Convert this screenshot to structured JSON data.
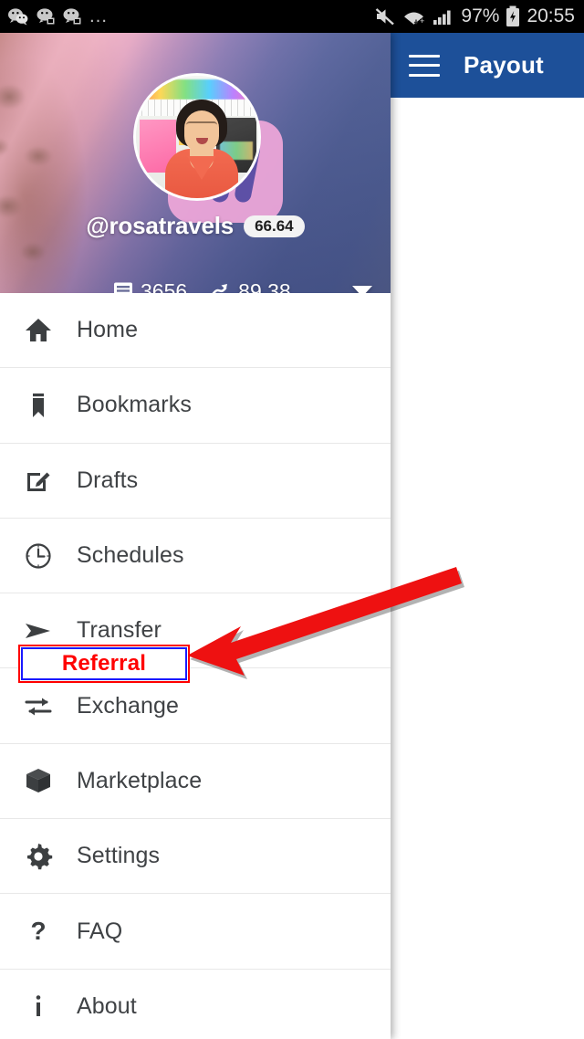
{
  "status_bar": {
    "left_icons": [
      "wechat-icon",
      "wechat-message-icon",
      "wechat-message-icon"
    ],
    "overflow_dots": "…",
    "mute_icon": "mute-icon",
    "wifi_icon": "wifi-icon",
    "signal_icon": "signal-bars-icon",
    "battery_percent": "97%",
    "battery_icon": "battery-charging-icon",
    "clock": "20:55"
  },
  "drawer": {
    "profile": {
      "avatar": "user-avatar",
      "username": "@rosatravels",
      "reputation": "66.64",
      "stats": [
        {
          "icon": "post-count-icon",
          "value": "3656"
        },
        {
          "icon": "trending-up-icon",
          "value": "89.38"
        }
      ],
      "expand_icon": "chevron-down-icon"
    },
    "menu_items": [
      {
        "icon": "home-icon",
        "label": "Home"
      },
      {
        "icon": "bookmark-icon",
        "label": "Bookmarks"
      },
      {
        "icon": "edit-square-icon",
        "label": "Drafts"
      },
      {
        "icon": "clock-icon",
        "label": "Schedules"
      },
      {
        "icon": "send-icon",
        "label": "Transfer"
      },
      {
        "icon": "exchange-icon",
        "label": "Exchange"
      },
      {
        "icon": "box-icon",
        "label": "Marketplace"
      },
      {
        "icon": "gear-icon",
        "label": "Settings"
      },
      {
        "icon": "question-icon",
        "label": "FAQ"
      },
      {
        "icon": "info-icon",
        "label": "About"
      }
    ]
  },
  "app_behind": {
    "menu_icon": "hamburger-menu-icon",
    "title": "Payout",
    "appbar_color": "#1d5099"
  },
  "annotation": {
    "label": "Referral",
    "box_border_outer_color": "#ff0000",
    "box_border_inner_color": "#1a1aff",
    "text_color": "#ff0000",
    "arrow_color": "#ee1111",
    "arrow_icon": "pointer-arrow-icon"
  }
}
